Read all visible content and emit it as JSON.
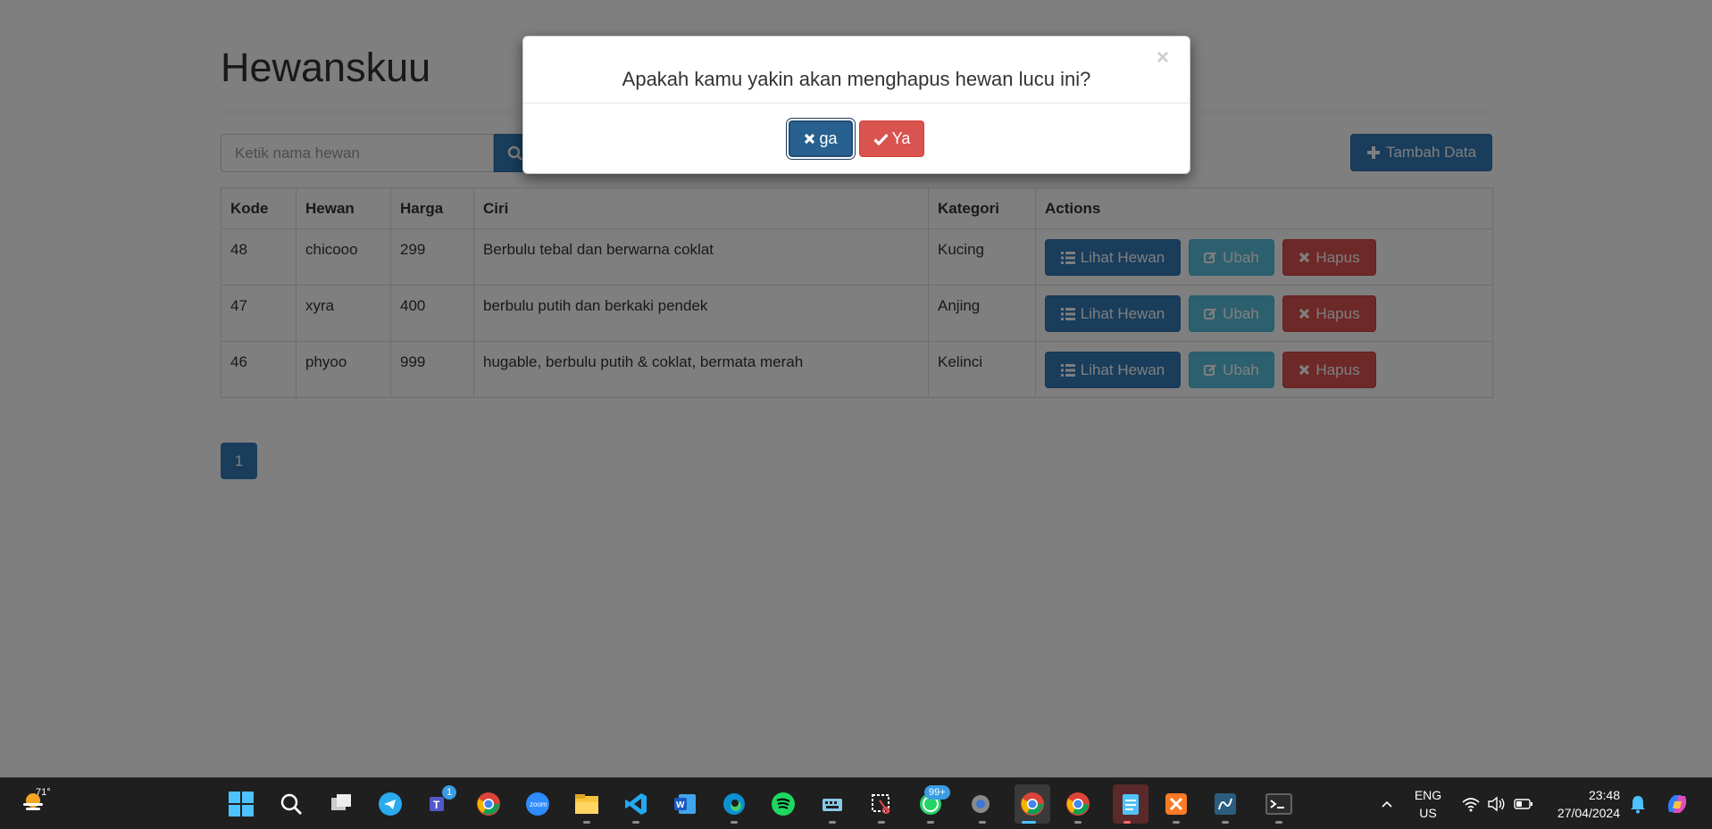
{
  "page": {
    "title": "Hewanskuu",
    "search_placeholder": "Ketik nama hewan",
    "add_button": "Tambah Data"
  },
  "table": {
    "headers": [
      "Kode",
      "Hewan",
      "Harga",
      "Ciri",
      "Kategori",
      "Actions"
    ],
    "rows": [
      {
        "kode": "48",
        "hewan": "chicooo",
        "harga": "299",
        "ciri": "Berbulu tebal dan berwarna coklat",
        "kategori": "Kucing"
      },
      {
        "kode": "47",
        "hewan": "xyra",
        "harga": "400",
        "ciri": "berbulu putih dan berkaki pendek",
        "kategori": "Anjing"
      },
      {
        "kode": "46",
        "hewan": "phyoo",
        "harga": "999",
        "ciri": "hugable, berbulu putih & coklat, bermata merah",
        "kategori": "Kelinci"
      }
    ],
    "actions": {
      "view": "Lihat Hewan",
      "edit": "Ubah",
      "delete": "Hapus"
    }
  },
  "pagination": {
    "current": "1"
  },
  "modal": {
    "question": "Apakah kamu yakin akan menghapus hewan lucu ini?",
    "close": "×",
    "cancel_label": "ga",
    "confirm_label": "Ya"
  },
  "taskbar": {
    "temperature": "71°",
    "language_line1": "ENG",
    "language_line2": "US",
    "time": "23:48",
    "date": "27/04/2024",
    "teams_badge": "1",
    "whatsapp_badge": "99+"
  },
  "colors": {
    "primary": "#337ab7",
    "info": "#5bc0de",
    "danger": "#d9534f",
    "taskbar": "#1f1f1f"
  }
}
